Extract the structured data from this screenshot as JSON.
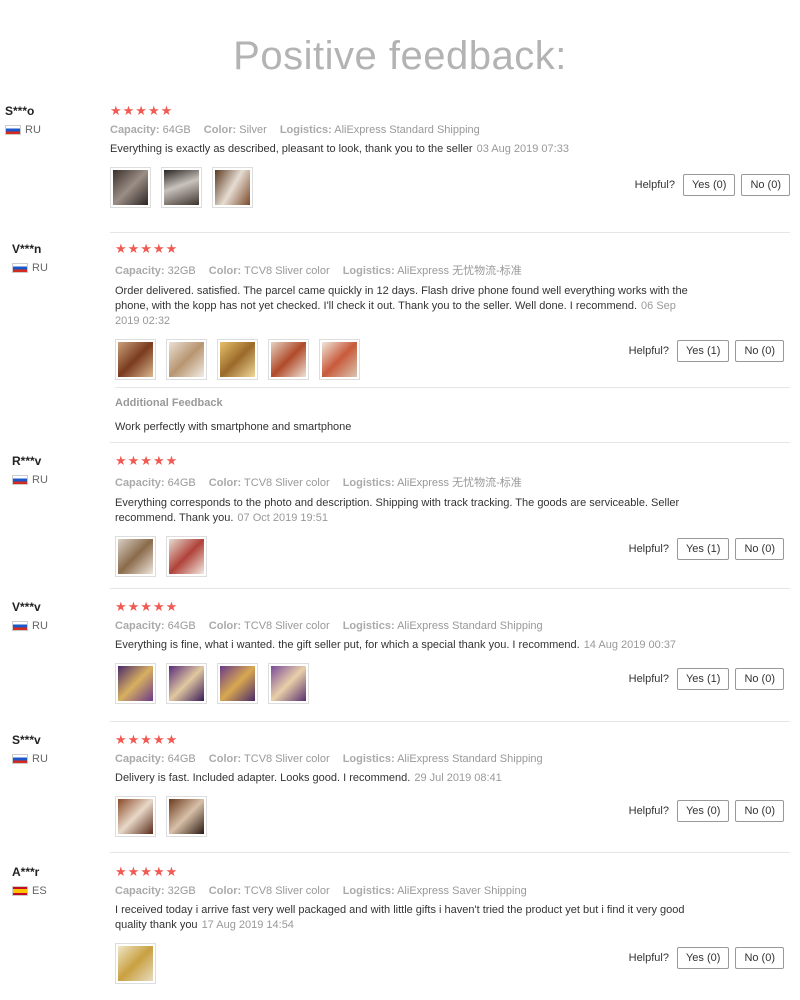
{
  "page_title": "Positive feedback:",
  "meta_labels": {
    "capacity": "Capacity:",
    "color": "Color:",
    "logistics": "Logistics:"
  },
  "helpful_label": "Helpful?",
  "stars_full": "★★★★★",
  "reviews": [
    {
      "user": "S***o",
      "country": "RU",
      "stars": "★★★★★",
      "capacity": "64GB",
      "color": "Silver",
      "logistics": "AliExpress Standard Shipping",
      "text": "Everything is exactly as described, pleasant to look, thank you to the seller",
      "date": "03 Aug 2019 07:33",
      "yes": "Yes (0)",
      "no": "No (0)"
    },
    {
      "user": "V***n",
      "country": "RU",
      "stars": "★★★★★",
      "capacity": "32GB",
      "color": "TCV8 Sliver color",
      "logistics": "AliExpress 无忧物流-标准",
      "text": "Order delivered. satisfied. The parcel came quickly in 12 days. Flash drive phone found well everything works with the phone, with the kopp has not yet checked. I'll check it out. Thank you to the seller. Well done. I recommend.",
      "date": "06 Sep 2019 02:32",
      "yes": "Yes (1)",
      "no": "No (0)",
      "additional_heading": "Additional Feedback",
      "additional_text": "Work perfectly with smartphone and smartphone"
    },
    {
      "user": "R***v",
      "country": "RU",
      "stars": "★★★★★",
      "capacity": "64GB",
      "color": "TCV8 Sliver color",
      "logistics": "AliExpress 无忧物流-标准",
      "text": "Everything corresponds to the photo and description. Shipping with track tracking. The goods are serviceable. Seller recommend. Thank you.",
      "date": "07 Oct 2019 19:51",
      "yes": "Yes (1)",
      "no": "No (0)"
    },
    {
      "user": "V***v",
      "country": "RU",
      "stars": "★★★★★",
      "capacity": "64GB",
      "color": "TCV8 Sliver color",
      "logistics": "AliExpress Standard Shipping",
      "text": "Everything is fine, what i wanted. the gift seller put, for which a special thank you. I recommend.",
      "date": "14 Aug 2019 00:37",
      "yes": "Yes (1)",
      "no": "No (0)"
    },
    {
      "user": "S***v",
      "country": "RU",
      "stars": "★★★★★",
      "capacity": "64GB",
      "color": "TCV8 Sliver color",
      "logistics": "AliExpress Standard Shipping",
      "text": "Delivery is fast. Included adapter. Looks good. I recommend.",
      "date": "29 Jul 2019 08:41",
      "yes": "Yes (0)",
      "no": "No (0)"
    },
    {
      "user": "A***r",
      "country": "ES",
      "stars": "★★★★★",
      "capacity": "32GB",
      "color": "TCV8 Sliver color",
      "logistics": "AliExpress Saver Shipping",
      "text": "I received today i arrive fast very well packaged and with little gifts i haven't tried the product yet but i find it very good quality thank you",
      "date": "17 Aug 2019 14:54",
      "yes": "Yes (0)",
      "no": "No (0)"
    }
  ],
  "colors": {
    "star": "#f05a53",
    "title": "#b3b3b3",
    "meta": "#999999"
  }
}
